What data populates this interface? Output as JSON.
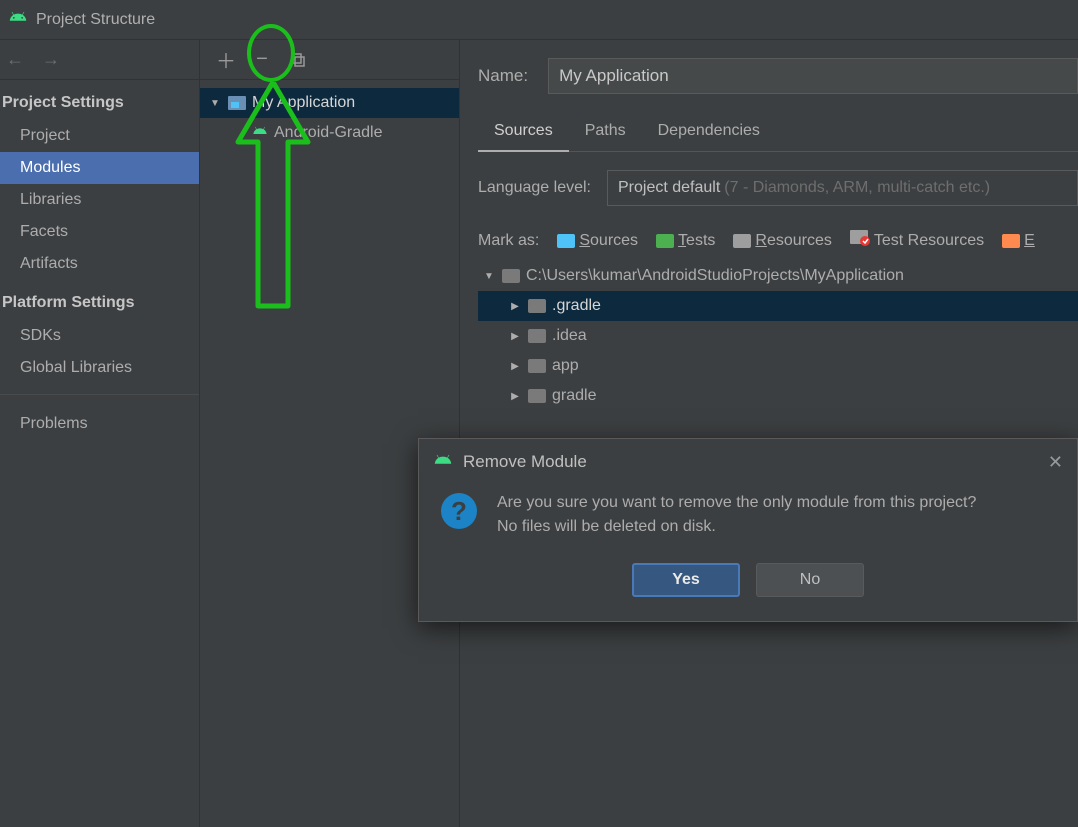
{
  "titlebar": {
    "title": "Project Structure"
  },
  "sidebar": {
    "section1": "Project Settings",
    "items1": [
      "Project",
      "Modules",
      "Libraries",
      "Facets",
      "Artifacts"
    ],
    "selected_index": 1,
    "section2": "Platform Settings",
    "items2": [
      "SDKs",
      "Global Libraries"
    ],
    "problems": "Problems"
  },
  "module_tree": {
    "root": "My Application",
    "child": "Android-Gradle"
  },
  "detail": {
    "name_label": "Name:",
    "name_value": "My Application",
    "tabs": [
      "Sources",
      "Paths",
      "Dependencies"
    ],
    "active_tab": 0,
    "lang_label": "Language level:",
    "lang_value": "Project default",
    "lang_hint": "(7 - Diamonds, ARM, multi-catch etc.)",
    "markas_label": "Mark as:",
    "markas": [
      {
        "label": "Sources",
        "u": "S",
        "rest": "ources",
        "color": "#4fc3f7"
      },
      {
        "label": "Tests",
        "u": "T",
        "rest": "ests",
        "color": "#4caf50"
      },
      {
        "label": "Resources",
        "u": "R",
        "rest": "esources",
        "color": "#9e9e9e"
      },
      {
        "label": "Test Resources",
        "u": "",
        "rest": "Test Resources",
        "color": "#9e9e9e",
        "badge": true
      },
      {
        "label": "E",
        "u": "E",
        "rest": "",
        "color": "#ff8a50"
      }
    ],
    "file_tree": {
      "root": "C:\\Users\\kumar\\AndroidStudioProjects\\MyApplication",
      "children": [
        ".gradle",
        ".idea",
        "app",
        "gradle"
      ],
      "selected_index": 0
    }
  },
  "dialog": {
    "title": "Remove Module",
    "line1": "Are you sure you want to remove the only module from this project?",
    "line2": "No files will be deleted on disk.",
    "yes": "Yes",
    "no": "No"
  }
}
